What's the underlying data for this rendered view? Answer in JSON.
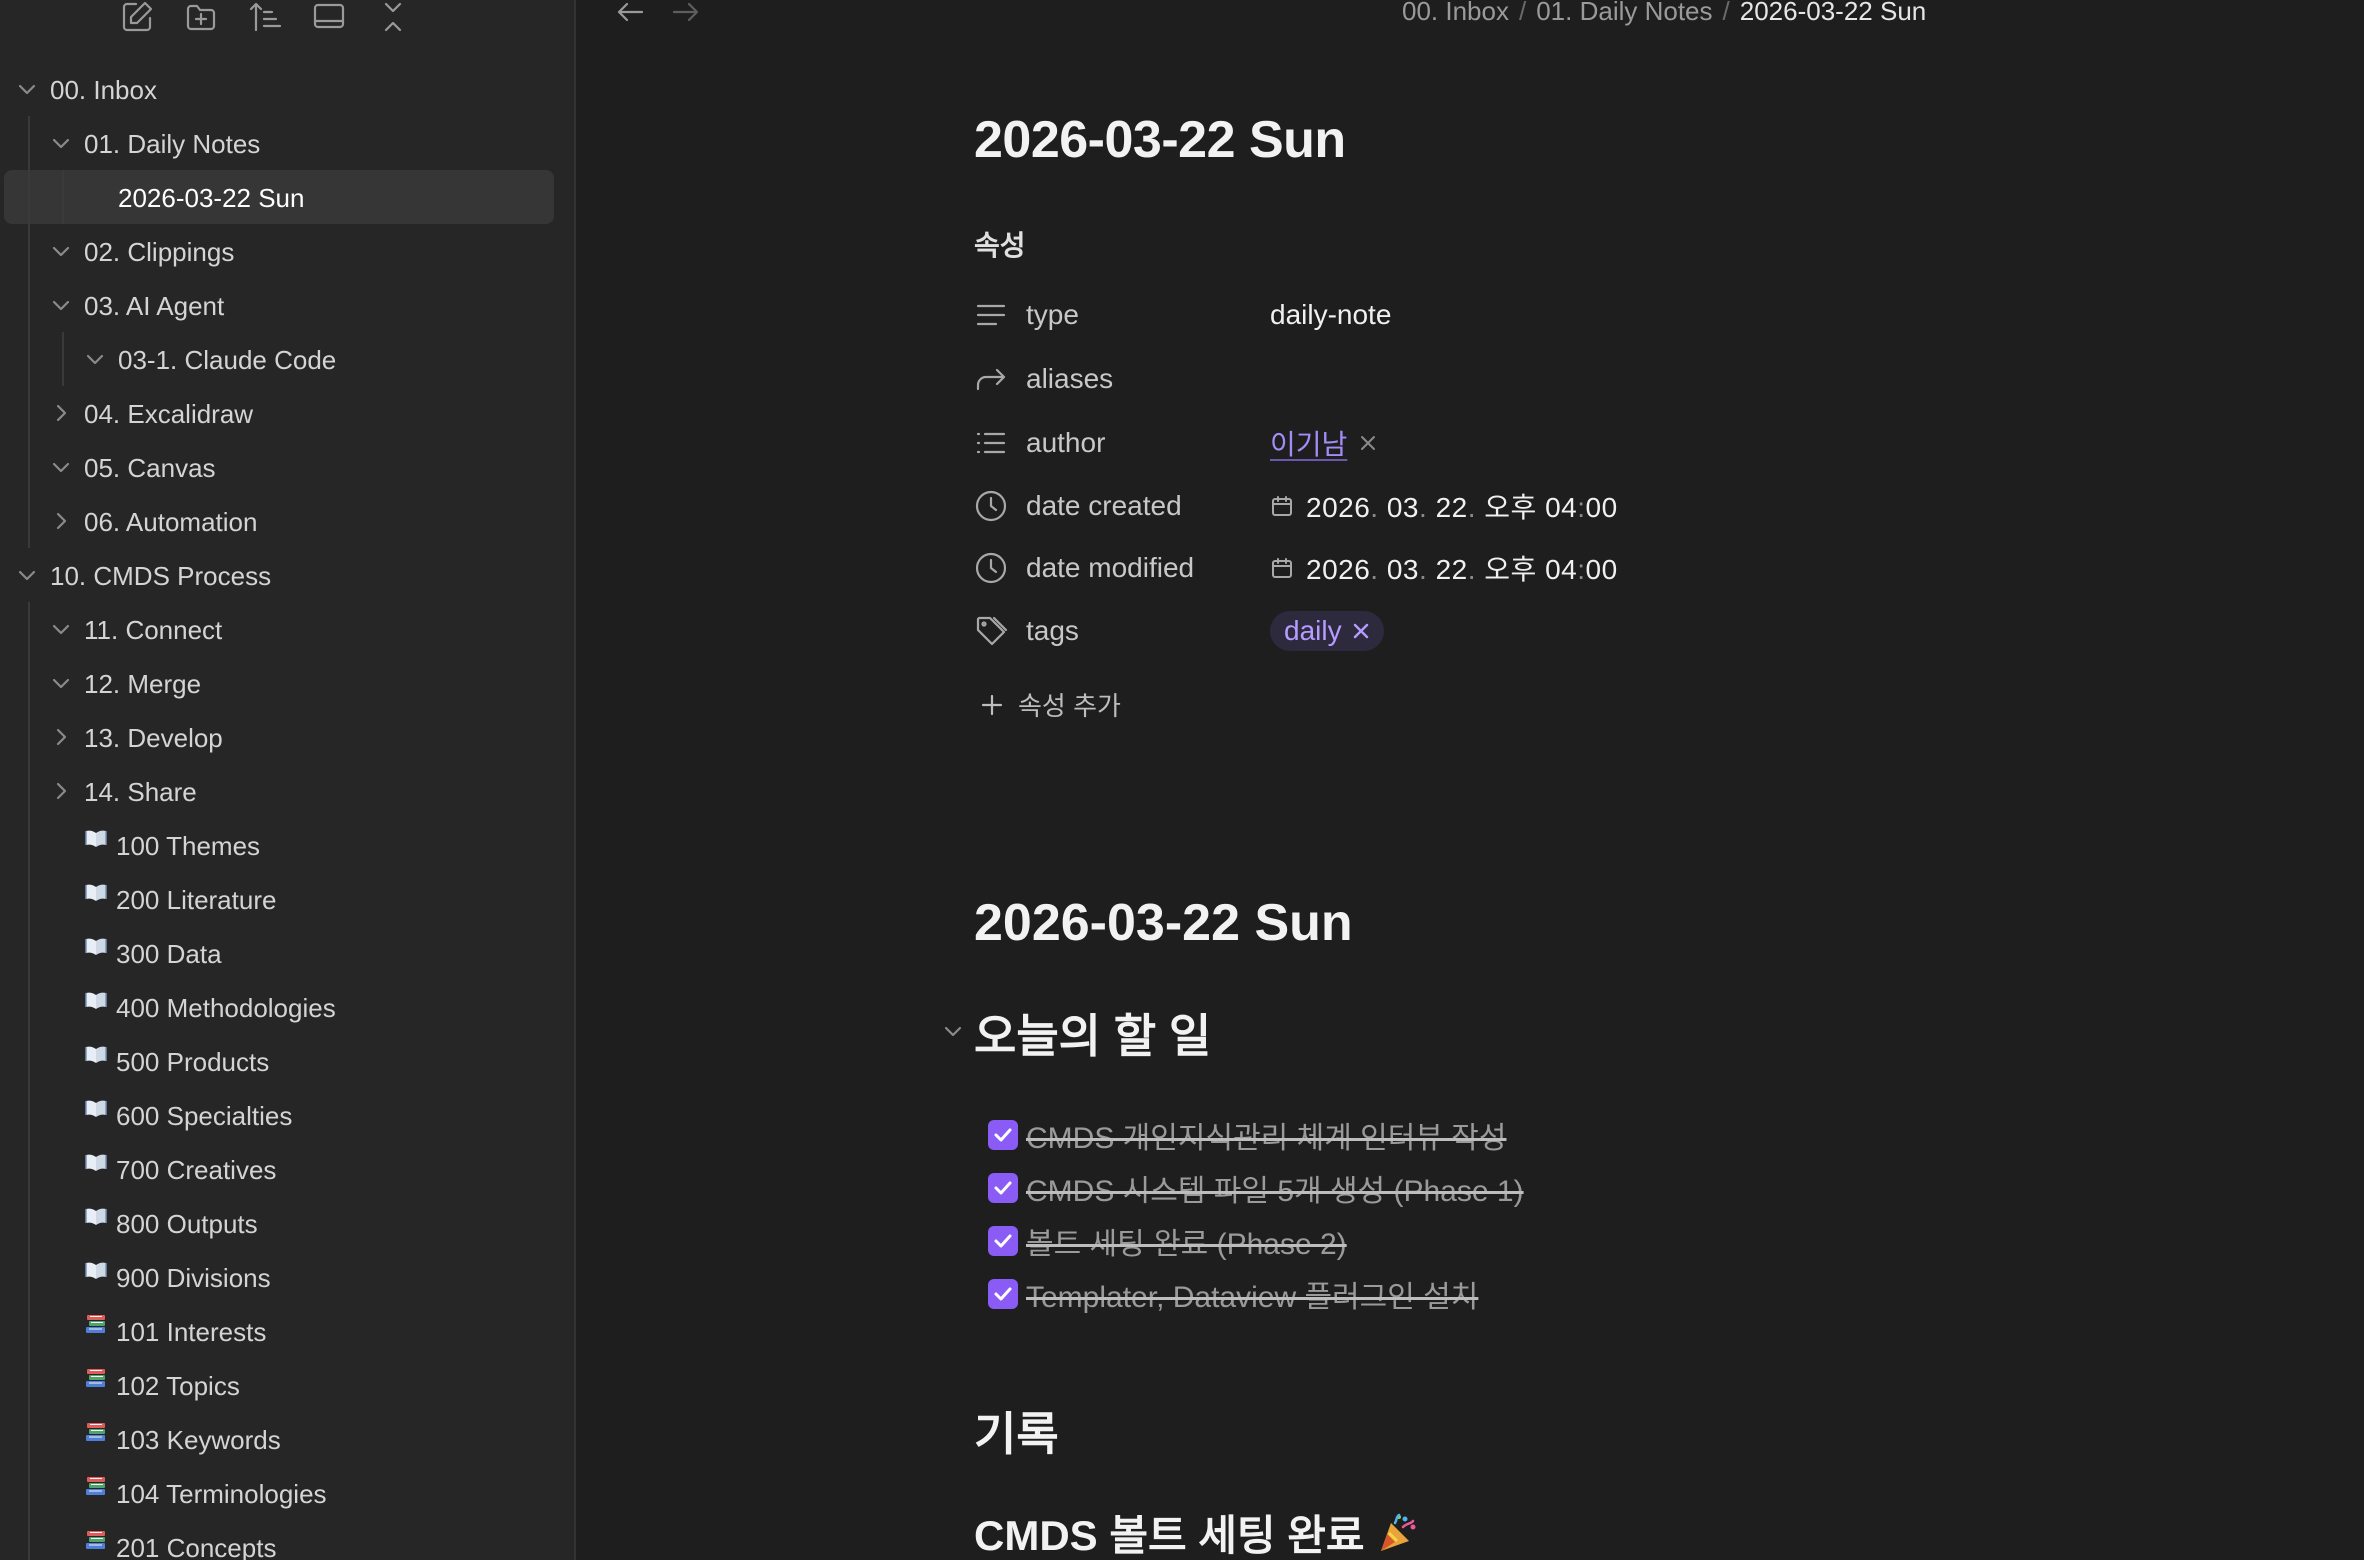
{
  "sidebar": {
    "toolbar": [
      {
        "name": "new-note-icon"
      },
      {
        "name": "new-folder-icon"
      },
      {
        "name": "sort-icon"
      },
      {
        "name": "reveal-active-icon"
      },
      {
        "name": "collapse-all-icon"
      }
    ],
    "tree": [
      {
        "label": "00. Inbox",
        "level": 0,
        "chevron": "down",
        "icon": ""
      },
      {
        "label": "01. Daily Notes",
        "level": 1,
        "chevron": "down",
        "icon": ""
      },
      {
        "label": "2026-03-22 Sun",
        "level": 2,
        "chevron": "",
        "icon": "",
        "active": true
      },
      {
        "label": "02. Clippings",
        "level": 1,
        "chevron": "down",
        "icon": ""
      },
      {
        "label": "03. AI Agent",
        "level": 1,
        "chevron": "down",
        "icon": ""
      },
      {
        "label": "03-1. Claude Code",
        "level": 2,
        "chevron": "down",
        "icon": ""
      },
      {
        "label": "04. Excalidraw",
        "level": 1,
        "chevron": "right",
        "icon": ""
      },
      {
        "label": "05. Canvas",
        "level": 1,
        "chevron": "down",
        "icon": ""
      },
      {
        "label": "06. Automation",
        "level": 1,
        "chevron": "right",
        "icon": ""
      },
      {
        "label": "10. CMDS Process",
        "level": 0,
        "chevron": "down",
        "icon": ""
      },
      {
        "label": "11. Connect",
        "level": 1,
        "chevron": "down",
        "icon": ""
      },
      {
        "label": "12. Merge",
        "level": 1,
        "chevron": "down",
        "icon": ""
      },
      {
        "label": "13. Develop",
        "level": 1,
        "chevron": "right",
        "icon": ""
      },
      {
        "label": "14. Share",
        "level": 1,
        "chevron": "right",
        "icon": ""
      },
      {
        "label": "100 Themes",
        "level": 1,
        "chevron": "",
        "icon": "book"
      },
      {
        "label": "200 Literature",
        "level": 1,
        "chevron": "",
        "icon": "book"
      },
      {
        "label": "300 Data",
        "level": 1,
        "chevron": "",
        "icon": "book"
      },
      {
        "label": "400 Methodologies",
        "level": 1,
        "chevron": "",
        "icon": "book"
      },
      {
        "label": "500 Products",
        "level": 1,
        "chevron": "",
        "icon": "book"
      },
      {
        "label": "600 Specialties",
        "level": 1,
        "chevron": "",
        "icon": "book"
      },
      {
        "label": "700 Creatives",
        "level": 1,
        "chevron": "",
        "icon": "book"
      },
      {
        "label": "800 Outputs",
        "level": 1,
        "chevron": "",
        "icon": "book"
      },
      {
        "label": "900 Divisions",
        "level": 1,
        "chevron": "",
        "icon": "book"
      },
      {
        "label": "101 Interests",
        "level": 1,
        "chevron": "",
        "icon": "books"
      },
      {
        "label": "102 Topics",
        "level": 1,
        "chevron": "",
        "icon": "books"
      },
      {
        "label": "103 Keywords",
        "level": 1,
        "chevron": "",
        "icon": "books"
      },
      {
        "label": "104 Terminologies",
        "level": 1,
        "chevron": "",
        "icon": "books"
      },
      {
        "label": "201 Concepts",
        "level": 1,
        "chevron": "",
        "icon": "books"
      }
    ]
  },
  "breadcrumb": {
    "items": [
      "00. Inbox",
      "01. Daily Notes",
      "2026-03-22 Sun"
    ],
    "separator": "/"
  },
  "note": {
    "title": "2026-03-22 Sun",
    "properties_heading": "속성",
    "properties": {
      "type": {
        "key": "type",
        "value": "daily-note",
        "icon": "text-lines-icon"
      },
      "aliases": {
        "key": "aliases",
        "value": "",
        "icon": "forward-arrow-icon"
      },
      "author": {
        "key": "author",
        "value": "이기남",
        "icon": "list-icon"
      },
      "date_created": {
        "key": "date created",
        "icon": "clock-icon",
        "year": "2026",
        "month": "03",
        "day": "22",
        "ampm": "오후",
        "hour": "04",
        "minute": "00"
      },
      "date_modified": {
        "key": "date modified",
        "icon": "clock-icon",
        "year": "2026",
        "month": "03",
        "day": "22",
        "ampm": "오후",
        "hour": "04",
        "minute": "00"
      },
      "tags": {
        "key": "tags",
        "value": "daily",
        "icon": "tag-icon"
      }
    },
    "add_property_label": "속성 추가",
    "heading_repeat": "2026-03-22 Sun",
    "todo_heading": "오늘의 할 일",
    "tasks": [
      {
        "text": "CMDS 개인지식관리 체계 인터뷰 작성",
        "done": true
      },
      {
        "text": "CMDS 시스템 파일 5개 생성 (Phase 1)",
        "done": true
      },
      {
        "text": "볼트 세팅 완료 (Phase 2)",
        "done": true
      },
      {
        "text": "Templater, Dataview 플러그인 설치",
        "done": true
      }
    ],
    "record_heading": "기록",
    "sub_heading": "CMDS 볼트 세팅 완료"
  },
  "colors": {
    "accent": "#8a5cf5",
    "link": "#a48cf6",
    "tag_text": "#b69cff",
    "background": "#1e1e1e",
    "sidebar_background": "#262626"
  }
}
